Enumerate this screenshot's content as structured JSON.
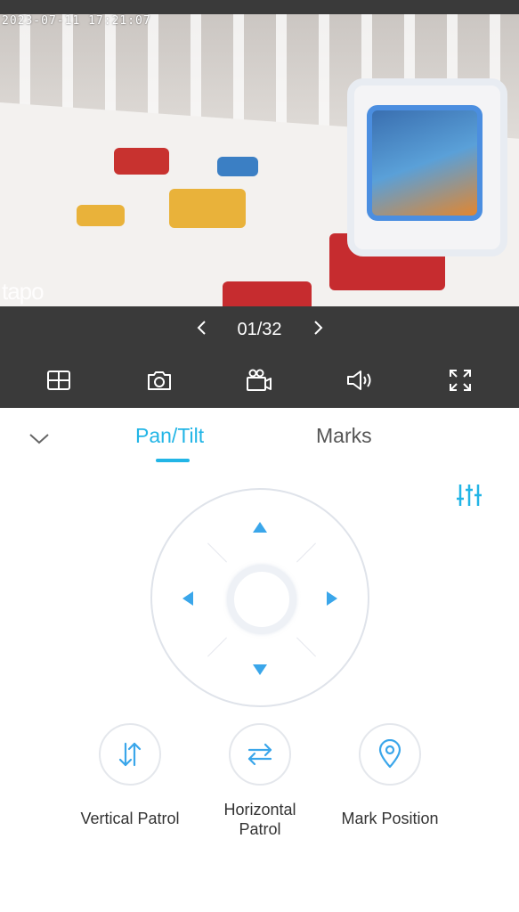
{
  "video": {
    "timestamp": "2023-07-11  17:21:07",
    "watermark": "tapo"
  },
  "pager": {
    "prev_icon": "chevron-left-icon",
    "count": "01/32",
    "next_icon": "chevron-right-icon"
  },
  "toolbar": {
    "tools": [
      "grid-layout-icon",
      "camera-snapshot-icon",
      "video-record-icon",
      "speaker-icon",
      "fullscreen-icon"
    ]
  },
  "tabs": {
    "collapse_icon": "chevron-down-icon",
    "items": [
      {
        "label": "Pan/Tilt",
        "active": true
      },
      {
        "label": "Marks",
        "active": false
      }
    ]
  },
  "settings_icon": "sliders-icon",
  "joystick": {
    "directions": [
      "up",
      "left",
      "right",
      "down"
    ]
  },
  "actions": [
    {
      "label": "Vertical Patrol",
      "icon": "vertical-arrows-icon"
    },
    {
      "label": "Horizontal Patrol",
      "icon": "horizontal-arrows-icon"
    },
    {
      "label": "Mark Position",
      "icon": "location-pin-icon"
    }
  ],
  "colors": {
    "accent": "#22b5e6",
    "icon_blue": "#3aa6ea",
    "dark_bar": "#3a3a3a"
  }
}
